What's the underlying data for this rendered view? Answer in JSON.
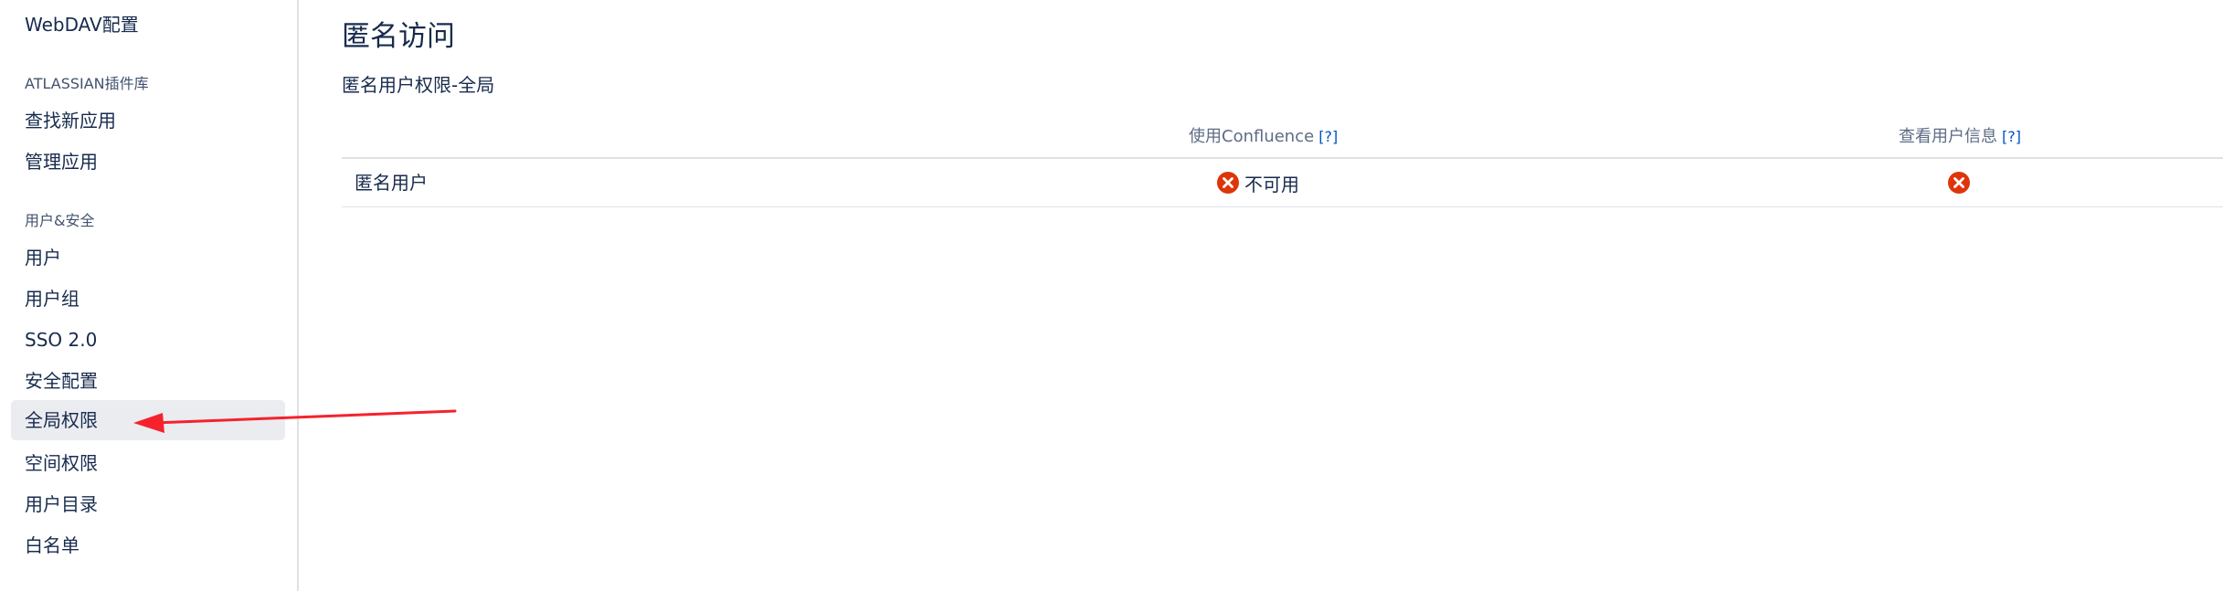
{
  "sidebar": {
    "items": [
      {
        "label": "WebDAV配置"
      },
      {
        "label": "查找新应用"
      },
      {
        "label": "管理应用"
      },
      {
        "label": "用户"
      },
      {
        "label": "用户组"
      },
      {
        "label": "SSO 2.0"
      },
      {
        "label": "安全配置"
      },
      {
        "label": "全局权限",
        "active": true
      },
      {
        "label": "空间权限"
      },
      {
        "label": "用户目录"
      },
      {
        "label": "白名单"
      }
    ],
    "sections": [
      {
        "label": "ATLASSIAN插件库"
      },
      {
        "label": "用户&安全"
      }
    ]
  },
  "main": {
    "page_title": "匿名访问",
    "section_title": "匿名用户权限-全局",
    "columns": [
      {
        "label": "使用Confluence",
        "help": "[?]"
      },
      {
        "label": "查看用户信息",
        "help": "[?]"
      }
    ],
    "rows": [
      {
        "label": "匿名用户",
        "use_confluence_text": "不可用",
        "use_confluence_icon": "disabled-x-icon",
        "view_profile_icon": "disabled-x-icon"
      }
    ]
  },
  "colors": {
    "accent_link": "#0052cc",
    "error_icon": "#de350b",
    "active_bg": "#ebecf0",
    "annotation_arrow": "#f5222d"
  }
}
